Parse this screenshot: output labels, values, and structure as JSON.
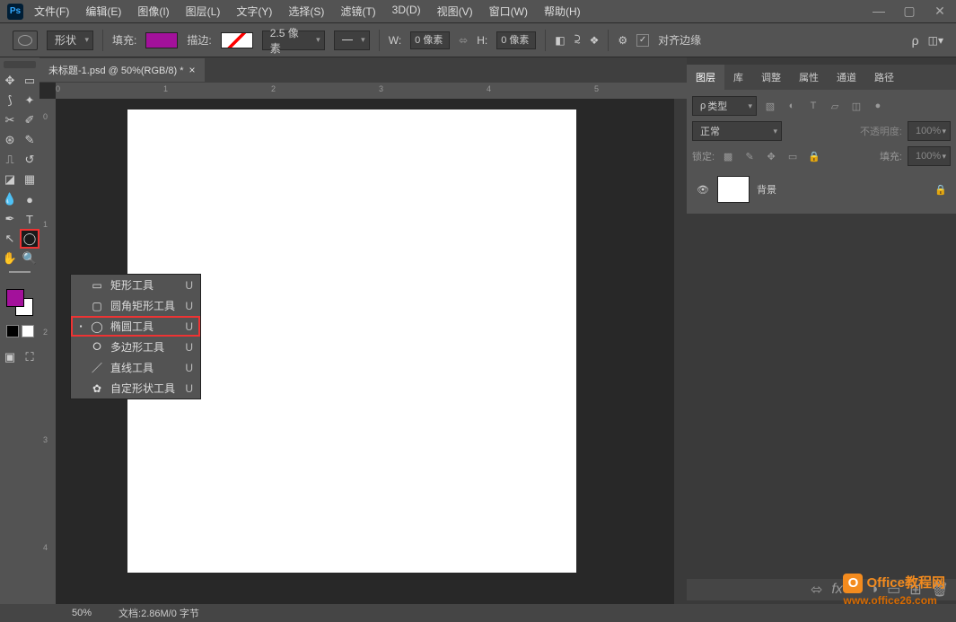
{
  "menu": [
    "文件(F)",
    "编辑(E)",
    "图像(I)",
    "图层(L)",
    "文字(Y)",
    "选择(S)",
    "滤镜(T)",
    "3D(D)",
    "视图(V)",
    "窗口(W)",
    "帮助(H)"
  ],
  "window": {
    "min": "—",
    "max": "▢",
    "close": "✕"
  },
  "options": {
    "shape_mode": "形状",
    "fill_label": "填充:",
    "stroke_label": "描边:",
    "stroke_width": "2.5 像素",
    "w_label": "W:",
    "w_val": "0 像素",
    "h_label": "H:",
    "h_val": "0 像素",
    "align_label": "对齐边缘"
  },
  "doc": {
    "tab": "未标题-1.psd @ 50%(RGB/8) *"
  },
  "ruler_h": [
    "0",
    "1",
    "2",
    "3",
    "4",
    "5"
  ],
  "ruler_v": [
    "0",
    "1",
    "2",
    "3",
    "4"
  ],
  "flyout": [
    {
      "dot": "",
      "icon": "▭",
      "label": "矩形工具",
      "key": "U"
    },
    {
      "dot": "",
      "icon": "▢",
      "label": "圆角矩形工具",
      "key": "U"
    },
    {
      "dot": "▪",
      "icon": "◯",
      "label": "椭圆工具",
      "key": "U",
      "sel": true
    },
    {
      "dot": "",
      "icon": "⭘",
      "label": "多边形工具",
      "key": "U"
    },
    {
      "dot": "",
      "icon": "／",
      "label": "直线工具",
      "key": "U"
    },
    {
      "dot": "",
      "icon": "✿",
      "label": "自定形状工具",
      "key": "U"
    }
  ],
  "panels": {
    "tabs": [
      "图层",
      "库",
      "调整",
      "属性",
      "通道",
      "路径"
    ],
    "search": "类型",
    "blend": "正常",
    "opacity_label": "不透明度:",
    "opacity": "100%",
    "lock_label": "锁定:",
    "fill_label": "填充:",
    "fill": "100%",
    "layer_name": "背景"
  },
  "status": {
    "zoom": "50%",
    "doc": "文档:2.86M/0 字节"
  },
  "watermark": {
    "l1": "Office教程网",
    "l2": "www.office26.com"
  },
  "search_ph": "ρ"
}
